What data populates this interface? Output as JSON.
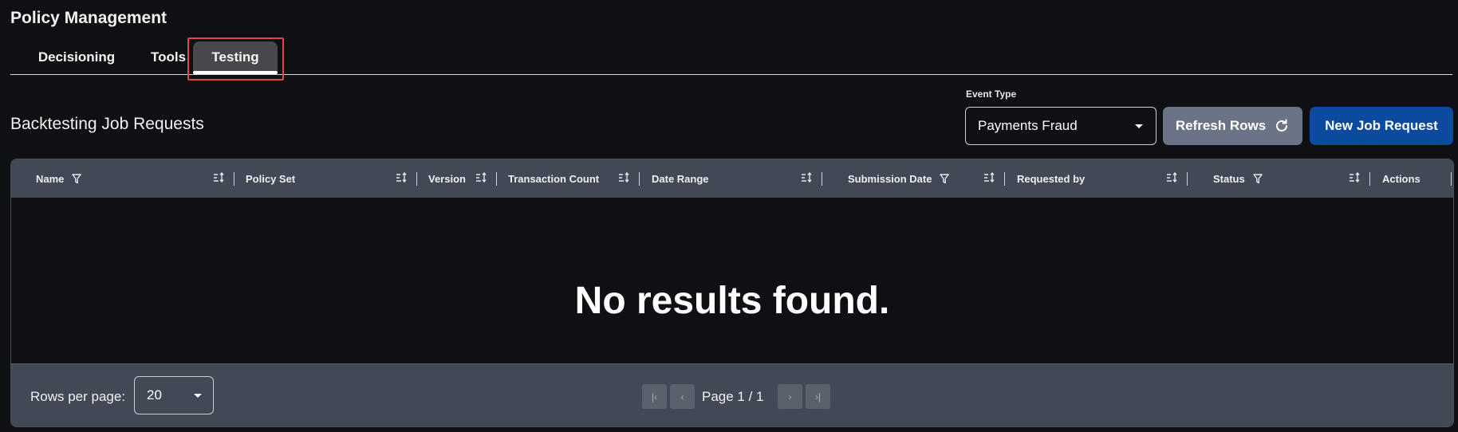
{
  "page": {
    "title": "Policy Management"
  },
  "tabs": [
    {
      "label": "Decisioning",
      "active": false
    },
    {
      "label": "Tools",
      "active": false
    },
    {
      "label": "Testing",
      "active": true
    }
  ],
  "section": {
    "title": "Backtesting Job Requests"
  },
  "controls": {
    "event_type_label": "Event Type",
    "event_type_value": "Payments Fraud",
    "refresh_label": "Refresh Rows",
    "new_job_label": "New Job Request"
  },
  "table": {
    "columns": [
      {
        "label": "Name",
        "filter": true,
        "sort": true
      },
      {
        "label": "Policy Set",
        "filter": false,
        "sort": true
      },
      {
        "label": "Version",
        "filter": false,
        "sort": true
      },
      {
        "label": "Transaction Count",
        "filter": false,
        "sort": true
      },
      {
        "label": "Date Range",
        "filter": false,
        "sort": true
      },
      {
        "label": "Submission Date",
        "filter": true,
        "sort": true
      },
      {
        "label": "Requested by",
        "filter": false,
        "sort": true
      },
      {
        "label": "Status",
        "filter": true,
        "sort": true
      },
      {
        "label": "Actions",
        "filter": false,
        "sort": false
      }
    ],
    "empty_message": "No results found."
  },
  "pagination": {
    "rows_per_page_label": "Rows per page:",
    "rows_per_page_value": "20",
    "page_label": "Page 1 / 1",
    "first_icon": "first-page-icon",
    "prev_icon": "chevron-left-icon",
    "next_icon": "chevron-right-icon",
    "last_icon": "last-page-icon"
  },
  "colors": {
    "background": "#0f1014",
    "table_header": "#434856",
    "refresh_button": "#6b7386",
    "primary_button": "#0b4a9c",
    "active_tab": "#48484c",
    "highlight_box": "#e04848"
  }
}
